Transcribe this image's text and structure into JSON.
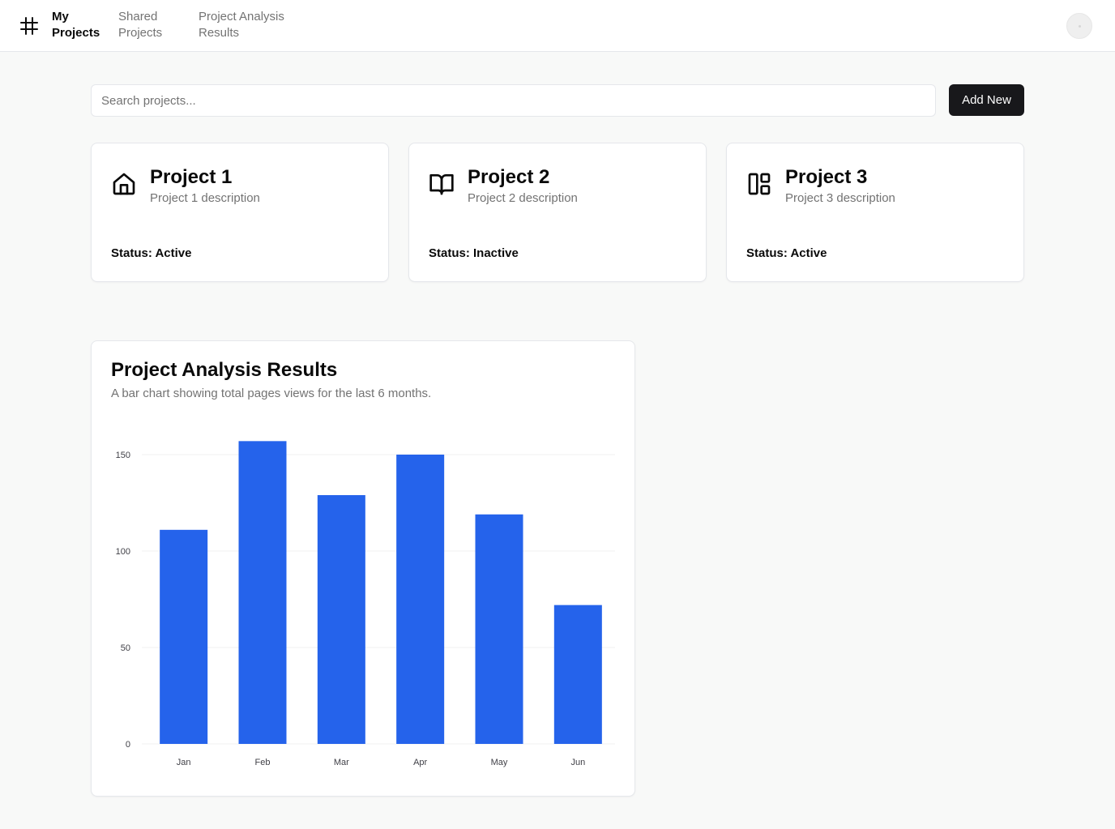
{
  "header": {
    "nav": [
      {
        "label_line1": "My",
        "label_line2": "Projects",
        "active": true
      },
      {
        "label_line1": "Shared",
        "label_line2": "Projects",
        "active": false
      },
      {
        "label_line1": "Project Analysis",
        "label_line2": "Results",
        "active": false
      }
    ],
    "logo_icon": "hash-icon",
    "avatar_icon": "user-avatar"
  },
  "toolbar": {
    "search_placeholder": "Search projects...",
    "search_value": "",
    "add_label": "Add New"
  },
  "projects": [
    {
      "title": "Project 1",
      "description": "Project 1 description",
      "status": "Status: Active",
      "icon": "home-icon"
    },
    {
      "title": "Project 2",
      "description": "Project 2 description",
      "status": "Status: Inactive",
      "icon": "book-open-icon"
    },
    {
      "title": "Project 3",
      "description": "Project 3 description",
      "status": "Status: Active",
      "icon": "layout-dashboard-icon"
    }
  ],
  "analysis": {
    "title": "Project Analysis Results",
    "subtitle": "A bar chart showing total pages views for the last 6 months."
  },
  "colors": {
    "bar": "#2563eb",
    "button_bg": "#18181b",
    "gridline": "#f0f0f0"
  },
  "chart_data": {
    "type": "bar",
    "categories": [
      "Jan",
      "Feb",
      "Mar",
      "Apr",
      "May",
      "Jun"
    ],
    "values": [
      111,
      157,
      129,
      150,
      119,
      72
    ],
    "yticks": [
      0,
      50,
      100,
      150
    ],
    "ylim": [
      0,
      150
    ],
    "grid": true,
    "legend": "none"
  }
}
